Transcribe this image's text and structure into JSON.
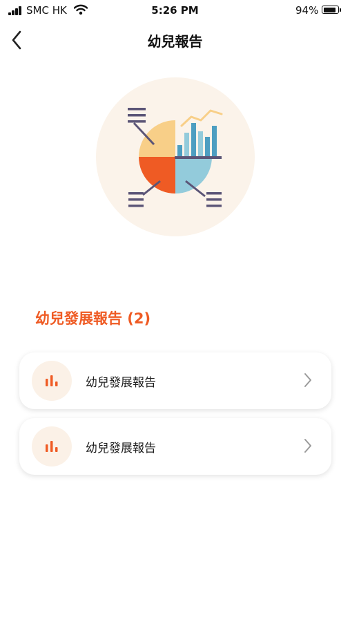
{
  "status_bar": {
    "carrier": "SMC HK",
    "time": "5:26 PM",
    "battery_percent": "94%",
    "battery_level": 0.94
  },
  "nav": {
    "title": "幼兒報告",
    "back_icon": "chevron-left-icon"
  },
  "hero": {
    "illustration": "report-charts-illustration"
  },
  "section": {
    "title": "幼兒發展報告 (2)"
  },
  "reports": [
    {
      "label": "幼兒發展報告",
      "icon": "bar-chart-icon"
    },
    {
      "label": "幼兒發展報告",
      "icon": "bar-chart-icon"
    }
  ],
  "colors": {
    "accent": "#ef5b24",
    "hero_bg": "#fbf3ea",
    "pie_yellow": "#f8cf88",
    "pie_blue": "#93cbdb",
    "bar_blue": "#4d9ec1",
    "line_color": "#5b5577"
  }
}
